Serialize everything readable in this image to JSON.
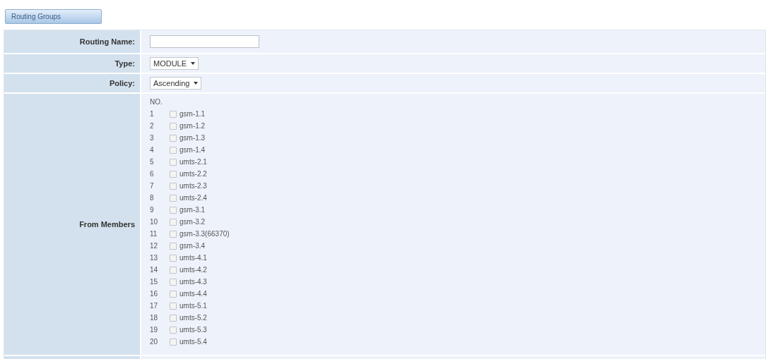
{
  "tab": {
    "label": "Routing Groups",
    "selected": true
  },
  "fields": [
    {
      "kind": "text",
      "label": "Routing Name:"
    },
    {
      "kind": "select",
      "label": "Type:",
      "value": "MODULE"
    },
    {
      "kind": "select",
      "label": "Policy:",
      "value": "Ascending"
    }
  ],
  "from_members": {
    "label": "From Members",
    "number_heading": "NO.",
    "members": [
      {
        "no": "1",
        "name": "gsm-1.1",
        "checked": false
      },
      {
        "no": "2",
        "name": "gsm-1.2",
        "checked": false
      },
      {
        "no": "3",
        "name": "gsm-1.3",
        "checked": false
      },
      {
        "no": "4",
        "name": "gsm-1.4",
        "checked": false
      },
      {
        "no": "5",
        "name": "umts-2.1",
        "checked": false
      },
      {
        "no": "6",
        "name": "umts-2.2",
        "checked": false
      },
      {
        "no": "7",
        "name": "umts-2.3",
        "checked": false
      },
      {
        "no": "8",
        "name": "umts-2.4",
        "checked": false
      },
      {
        "no": "9",
        "name": "gsm-3.1",
        "checked": false
      },
      {
        "no": "10",
        "name": "gsm-3.2",
        "checked": false
      },
      {
        "no": "11",
        "name": "gsm-3.3(66370)",
        "checked": false
      },
      {
        "no": "12",
        "name": "gsm-3.4",
        "checked": false
      },
      {
        "no": "13",
        "name": "umts-4.1",
        "checked": false
      },
      {
        "no": "14",
        "name": "umts-4.2",
        "checked": false
      },
      {
        "no": "15",
        "name": "umts-4.3",
        "checked": false
      },
      {
        "no": "16",
        "name": "umts-4.4",
        "checked": false
      },
      {
        "no": "17",
        "name": "umts-5.1",
        "checked": false
      },
      {
        "no": "18",
        "name": "umts-5.2",
        "checked": false
      },
      {
        "no": "19",
        "name": "umts-5.3",
        "checked": false
      },
      {
        "no": "20",
        "name": "umts-5.4",
        "checked": false
      }
    ]
  }
}
